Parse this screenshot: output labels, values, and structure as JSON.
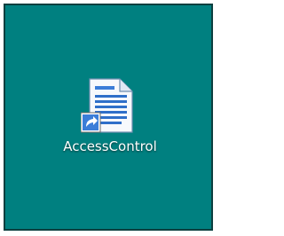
{
  "desktop": {
    "background_color": "#008080",
    "icons": [
      {
        "label": "AccessControl",
        "icon": "document-shortcut-icon",
        "is_shortcut": true
      }
    ]
  }
}
